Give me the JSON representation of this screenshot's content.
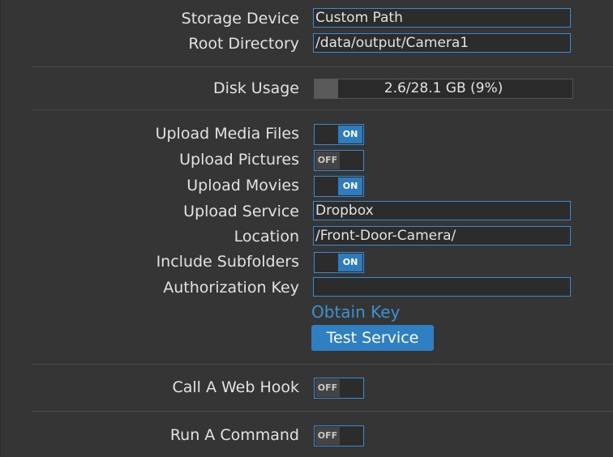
{
  "storage": {
    "device_label": "Storage Device",
    "device_value": "Custom Path",
    "root_label": "Root Directory",
    "root_value": "/data/output/Camera1"
  },
  "disk": {
    "label": "Disk Usage",
    "text": "2.6/28.1 GB (9%)",
    "percent": 9
  },
  "upload": {
    "media_label": "Upload Media Files",
    "media_state": "ON",
    "pictures_label": "Upload Pictures",
    "pictures_state": "OFF",
    "movies_label": "Upload Movies",
    "movies_state": "ON",
    "service_label": "Upload Service",
    "service_value": "Dropbox",
    "location_label": "Location",
    "location_value": "/Front-Door-Camera/",
    "subfolders_label": "Include Subfolders",
    "subfolders_state": "ON",
    "auth_label": "Authorization Key",
    "auth_value": "",
    "obtain_key_link": "Obtain Key",
    "test_button": "Test Service"
  },
  "webhook": {
    "label": "Call A Web Hook",
    "state": "OFF"
  },
  "command": {
    "label": "Run A Command",
    "state": "OFF"
  },
  "colors": {
    "background": "#353535",
    "accent": "#2f80c2",
    "link": "#3b92d6",
    "field_border": "#3b8ad0"
  }
}
